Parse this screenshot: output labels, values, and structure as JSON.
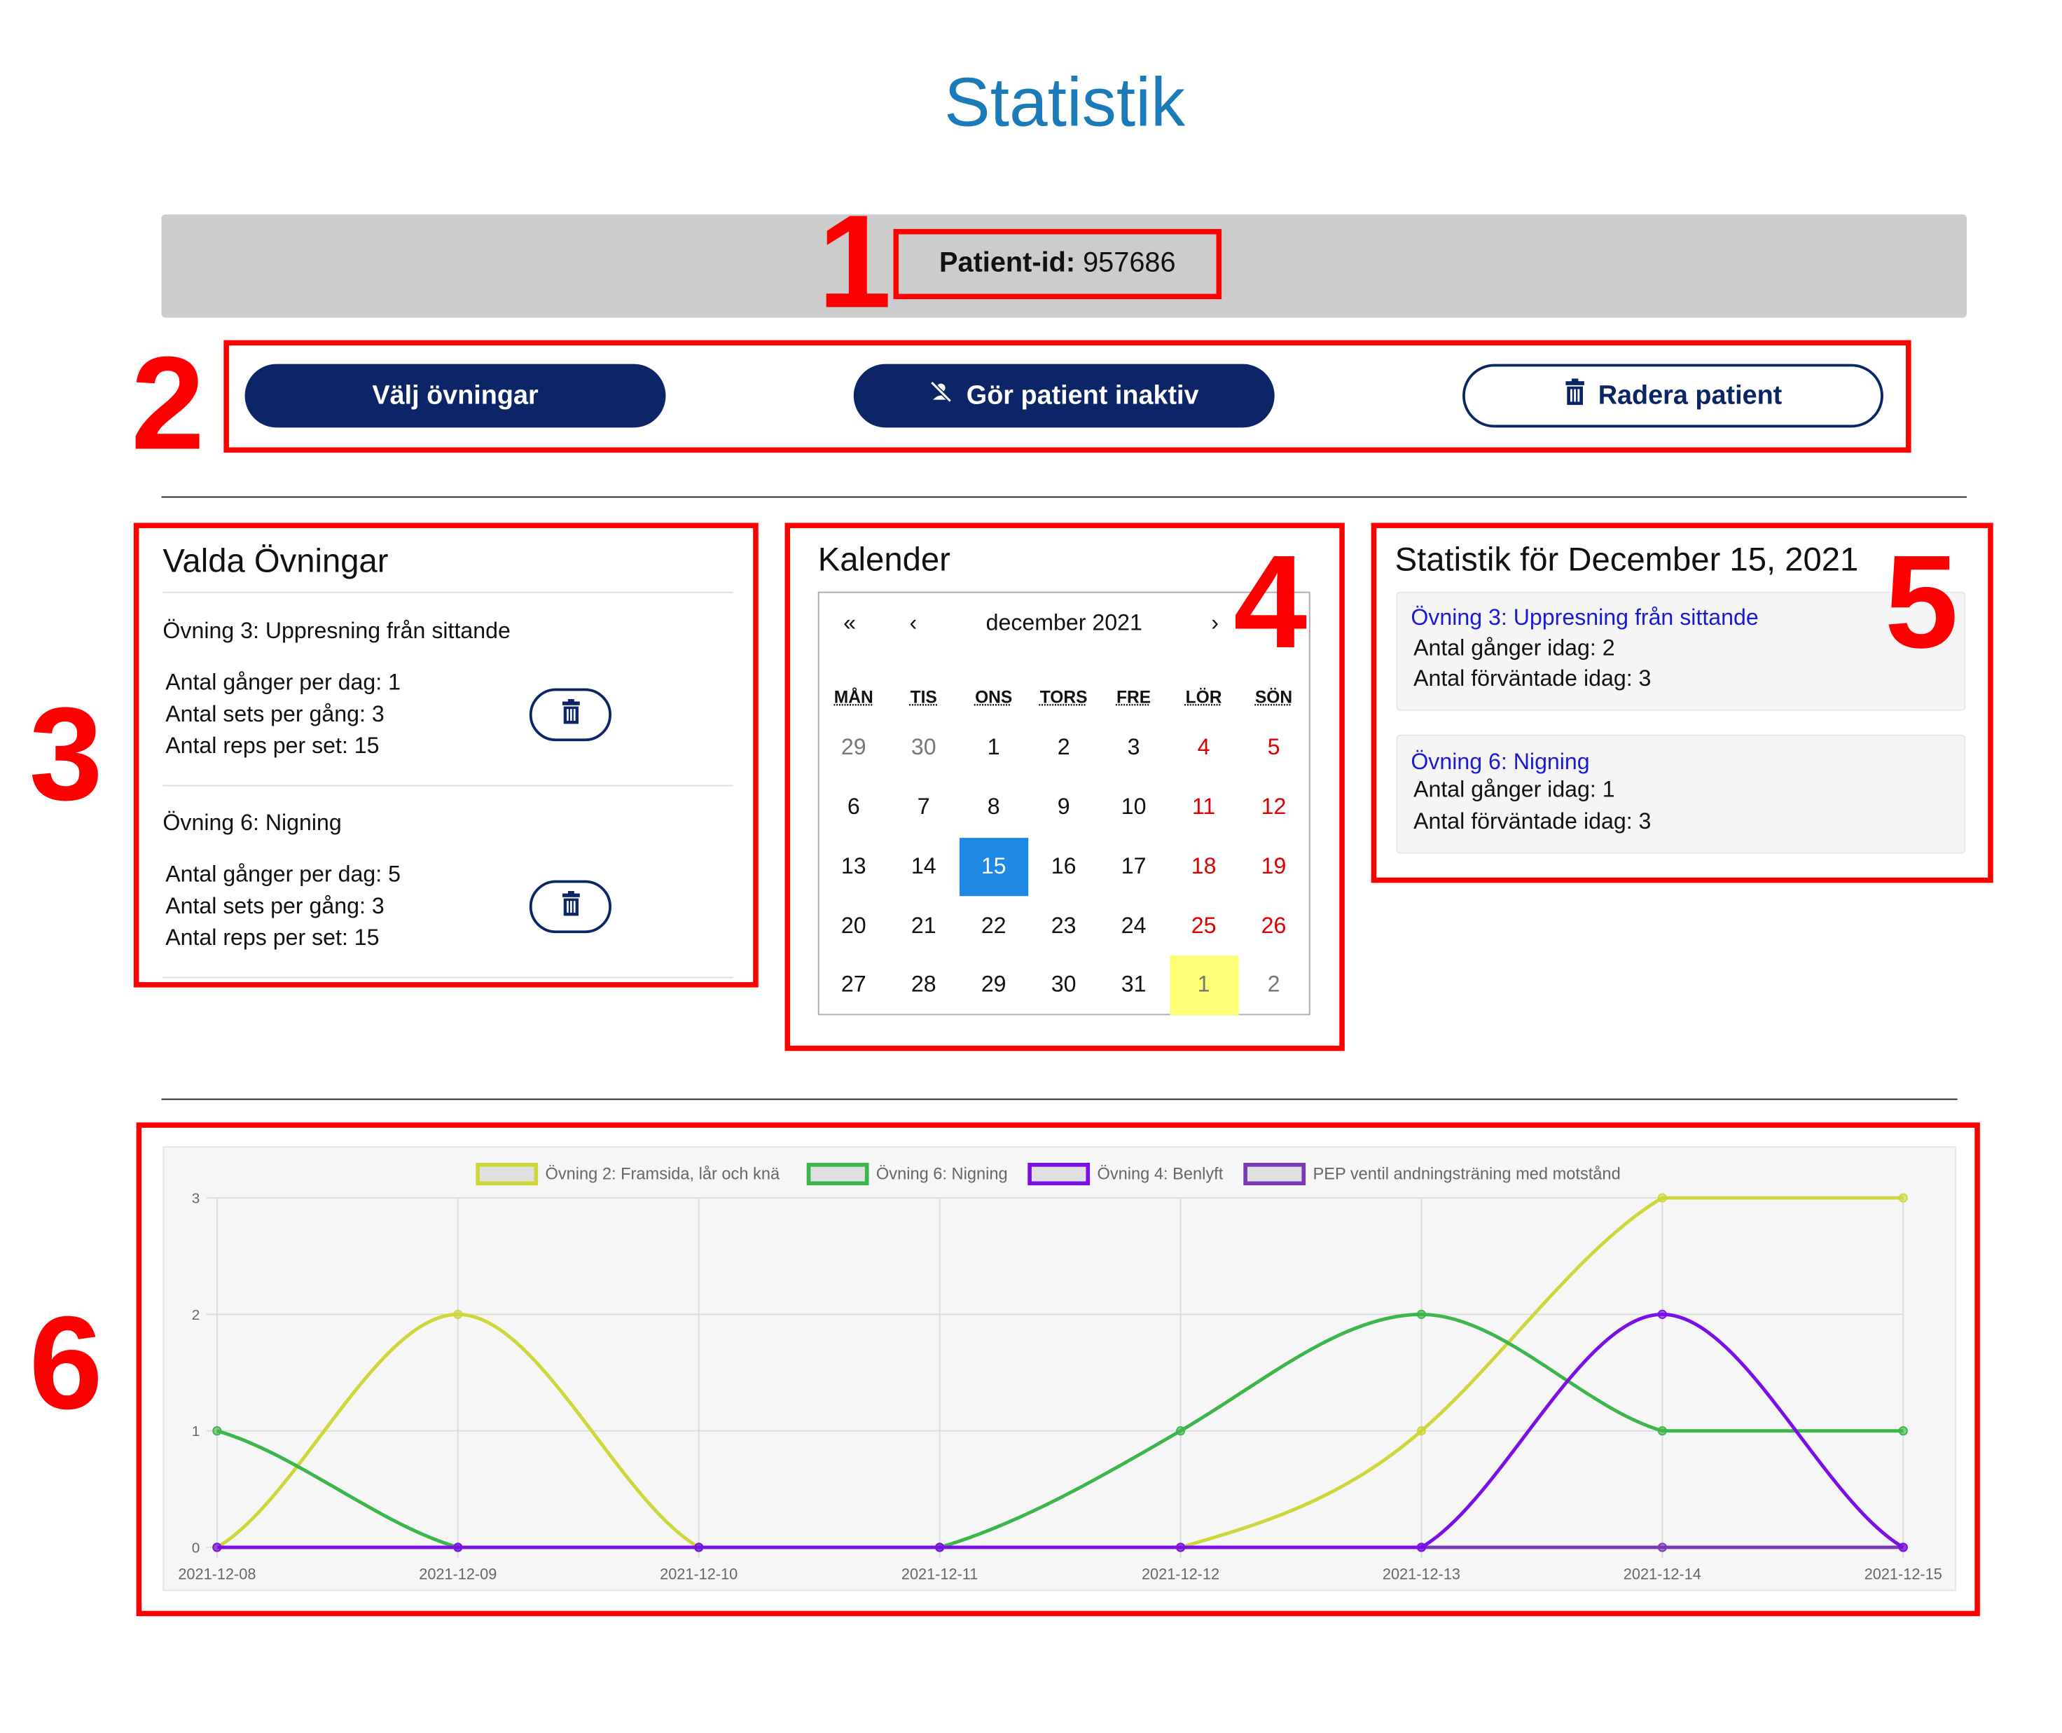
{
  "page": {
    "title": "Statistik"
  },
  "patient": {
    "label": "Patient-id:",
    "value": "957686"
  },
  "actions": {
    "select_exercises": "Välj övningar",
    "make_inactive": "Gör patient inaktiv",
    "delete_patient": "Radera patient"
  },
  "selected_exercises": {
    "title": "Valda Övningar",
    "items": [
      {
        "name": "Övning 3: Uppresning från sittande",
        "times": "Antal gånger per dag: 1",
        "sets": "Antal sets per gång: 3",
        "reps": "Antal reps per set: 15"
      },
      {
        "name": "Övning 6: Nigning",
        "times": "Antal gånger per dag: 5",
        "sets": "Antal sets per gång: 3",
        "reps": "Antal reps per set: 15"
      }
    ]
  },
  "calendar": {
    "title": "Kalender",
    "nav": {
      "prev_year": "«",
      "prev_month": "‹",
      "month_label": "december 2021",
      "next_month": "›",
      "next_year": "»"
    },
    "weekdays": [
      "MÅN",
      "TIS",
      "ONS",
      "TORS",
      "FRE",
      "LÖR",
      "SÖN"
    ],
    "weeks": [
      [
        "29",
        "30",
        "1",
        "2",
        "3",
        "4",
        "5"
      ],
      [
        "6",
        "7",
        "8",
        "9",
        "10",
        "11",
        "12"
      ],
      [
        "13",
        "14",
        "15",
        "16",
        "17",
        "18",
        "19"
      ],
      [
        "20",
        "21",
        "22",
        "23",
        "24",
        "25",
        "26"
      ],
      [
        "27",
        "28",
        "29",
        "30",
        "31",
        "1",
        "2"
      ]
    ],
    "selected_day": "15",
    "today": "1"
  },
  "daily_stats": {
    "title": "Statistik för December 15, 2021",
    "cards": [
      {
        "name": "Övning 3: Uppresning från sittande",
        "done": "Antal gånger idag: 2",
        "expected": "Antal förväntade idag: 3"
      },
      {
        "name": "Övning 6: Nigning",
        "done": "Antal gånger idag: 1",
        "expected": "Antal förväntade idag: 3"
      }
    ]
  },
  "annotations": {
    "n1": "1",
    "n2": "2",
    "n3": "3",
    "n4": "4",
    "n5": "5",
    "n6": "6"
  },
  "colors": {
    "title": "#1a7bb8",
    "primary": "#0c2566",
    "annotation": "#ff0000",
    "selected_day": "#1e88e5",
    "today": "#ffff76",
    "weekend": "#dd0000"
  },
  "chart_data": {
    "type": "line",
    "x": [
      "2021-12-08",
      "2021-12-09",
      "2021-12-10",
      "2021-12-11",
      "2021-12-12",
      "2021-12-13",
      "2021-12-14",
      "2021-12-15"
    ],
    "ylim": [
      0,
      3
    ],
    "yticks": [
      "0",
      "1",
      "2",
      "3"
    ],
    "grid": true,
    "legend_position": "top",
    "series": [
      {
        "name": "Övning 2: Framsida, lår och knä",
        "color": "#cfd63a",
        "values": [
          0,
          2,
          0,
          0,
          0,
          1,
          3,
          3
        ]
      },
      {
        "name": "Övning 6: Nigning",
        "color": "#3cb54a",
        "values": [
          1,
          0,
          0,
          0,
          1,
          2,
          1,
          1
        ]
      },
      {
        "name": "Övning 4: Benlyft",
        "color": "#7a10e6",
        "values": [
          0,
          0,
          0,
          0,
          0,
          0,
          2,
          0
        ]
      },
      {
        "name": "PEP ventil andningsträning med motstånd",
        "color": "#7b3ab5",
        "values": [
          0,
          0,
          0,
          0,
          0,
          0,
          0,
          0
        ]
      }
    ]
  }
}
